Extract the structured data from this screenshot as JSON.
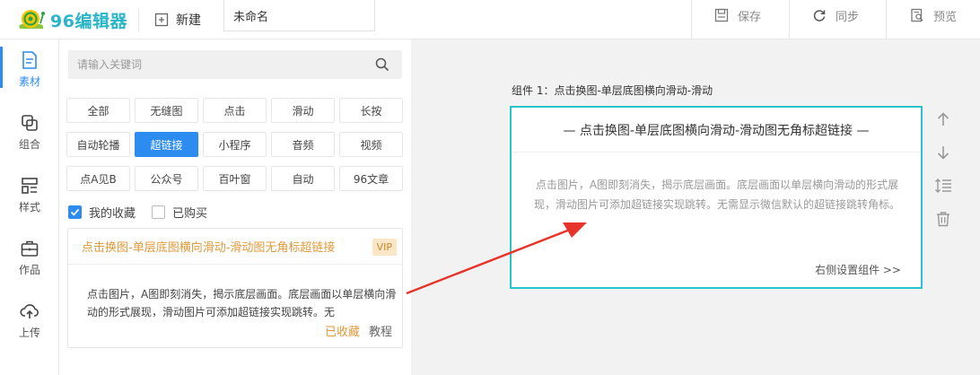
{
  "app": {
    "logo_text": "96编辑器"
  },
  "toolbar": {
    "new_label": "新建",
    "title_value": "未命名",
    "save_label": "保存",
    "sync_label": "同步",
    "preview_label": "预览"
  },
  "rail": {
    "items": [
      {
        "label": "素材",
        "icon": "material-icon",
        "active": true
      },
      {
        "label": "组合",
        "icon": "combine-icon",
        "active": false
      },
      {
        "label": "样式",
        "icon": "style-icon",
        "active": false
      },
      {
        "label": "作品",
        "icon": "works-icon",
        "active": false
      },
      {
        "label": "上传",
        "icon": "upload-icon",
        "active": false
      }
    ]
  },
  "panel": {
    "search_placeholder": "请输入关键词",
    "tags": [
      "全部",
      "无缝图",
      "点击",
      "滑动",
      "长按",
      "自动轮播",
      "超链接",
      "小程序",
      "音频",
      "视频",
      "点A见B",
      "公众号",
      "百叶窗",
      "自动",
      "96文章"
    ],
    "active_tag": "超链接",
    "checks": [
      {
        "label": "我的收藏",
        "checked": true
      },
      {
        "label": "已购买",
        "checked": false
      }
    ],
    "card": {
      "title": "点击换图-单层底图横向滑动-滑动图无角标超链接",
      "badge": "VIP",
      "description": "点击图片，A图即刻消失，揭示底层画面。底层画面以单层横向滑动的形式展现，滑动图片可添加超链接实现跳转。无",
      "fav_label": "已收藏",
      "tutorial_label": "教程"
    }
  },
  "canvas": {
    "component_label": "组件 1：点击换图-单层底图横向滑动-滑动",
    "component": {
      "title": "— 点击换图-单层底图横向滑动-滑动图无角标超链接 —",
      "description": "点击图片，A图即刻消失，揭示底层画面。底层画面以单层横向滑动的形式展现，滑动图片可添加超链接实现跳转。无需显示微信默认的超链接跳转角标。",
      "settings_link": "右侧设置组件 >>"
    },
    "tools": [
      "move-up-icon",
      "move-down-icon",
      "line-spacing-icon",
      "delete-icon"
    ]
  },
  "colors": {
    "accent": "#2d8cf0",
    "brand": "#29b6c8",
    "highlight_border": "#29c2cf",
    "favorite": "#e09a3b",
    "arrow": "#e8332a"
  }
}
